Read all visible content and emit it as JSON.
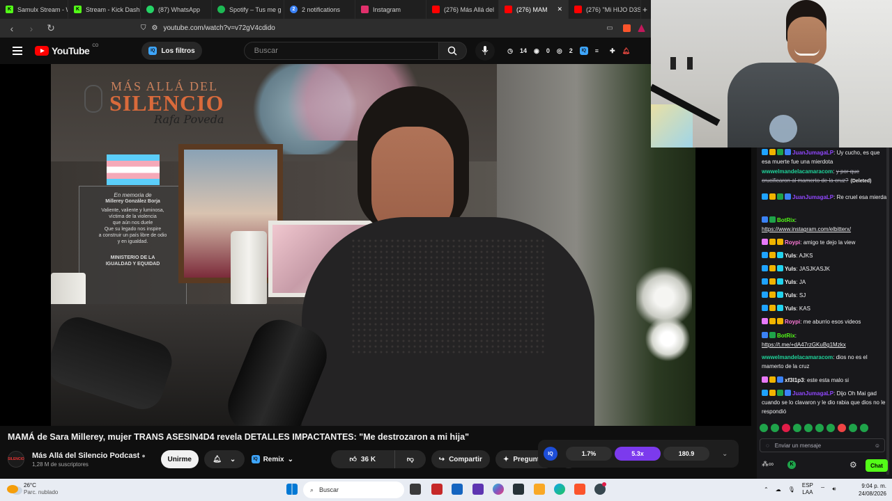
{
  "browser": {
    "tabs": [
      {
        "label": "Samulx Stream - W",
        "icon": "kick",
        "color": "#53fc18"
      },
      {
        "label": "Stream - Kick Dashb",
        "icon": "kick",
        "color": "#53fc18"
      },
      {
        "label": "(87) WhatsApp",
        "icon": "whatsapp",
        "color": "#25d366"
      },
      {
        "label": "Spotify – Tus me g",
        "icon": "spotify",
        "color": "#1db954"
      },
      {
        "label": "2 notifications",
        "icon": "notifications",
        "color": "#3b82f6"
      },
      {
        "label": "Instagram",
        "icon": "instagram",
        "color": "#e1306c"
      },
      {
        "label": "(276) Más Allá del",
        "icon": "youtube",
        "color": "#ff0000"
      },
      {
        "label": "(276) MAM",
        "icon": "youtube",
        "color": "#ff0000"
      },
      {
        "label": "(276) \"Mi HIJO D3S",
        "icon": "youtube",
        "color": "#ff0000"
      }
    ],
    "new_tab": "+",
    "url": "youtube.com/watch?v=v72gV4cdido"
  },
  "youtube": {
    "logo_text": "YouTube",
    "logo_cc": "CO",
    "filters_label": "Los filtros",
    "search_placeholder": "Buscar",
    "header_stats": {
      "timer": "14",
      "views": "0",
      "watch": "2"
    },
    "video_overlay": {
      "brand_line1": "MÁS ALLÁ DEL",
      "brand_line2": "SILENCIO",
      "brand_signature": "Rafa Poveda",
      "plaque_title": "En memoria de",
      "plaque_name": "Millerey González Borja",
      "plaque_lines": [
        "Valiente, valiente y luminosa,",
        "víctima de la violencia",
        "que aún nos duele",
        "Que su legado nos inspire",
        "a construir un país libre de odio",
        "y en igualdad."
      ],
      "plaque_footer1": "MINISTERIO DE LA",
      "plaque_footer2": "IGUALDAD Y EQUIDAD"
    },
    "video_title": "MAMÁ de Sara Millerey, mujer TRANS ASESIN4D4 revela DETALLES IMPACTANTES: \"Me destrozaron a mi hija\"",
    "channel": {
      "name": "Más Allá del Silencio Podcast",
      "subscribers": "1,28 M de suscriptores",
      "avatar_text": "SILENCIO"
    },
    "buttons": {
      "join": "Unirme",
      "remix": "Remix",
      "likes": "36 K",
      "share": "Compartir",
      "ask": "Preguntar"
    },
    "iq_panel": {
      "badge": "IQ",
      "values": [
        "1.7%",
        "5.3x",
        "180.9"
      ]
    }
  },
  "chat": {
    "messages": [
      {
        "user": "JuanJumagaLP",
        "color": "#9147ff",
        "text": "Uy cucho, es que esa muerte fue una mierdota",
        "badges": [
          "#1fa3ff",
          "#f0b400",
          "#1fa34a",
          "#3b82f6"
        ]
      },
      {
        "user": "wwwelmandelacamaracom",
        "color": "#1fd39a",
        "text": "y por que crucificaron al mamerto de la cruz?",
        "deleted": "(Deleted)",
        "badges": []
      },
      {
        "user": "JuanJumagaLP",
        "color": "#9147ff",
        "text": "Re cruel esa mierda",
        "badges": [
          "#1fa3ff",
          "#f0b400",
          "#1fa34a",
          "#3b82f6"
        ]
      },
      {
        "user": "BotRix",
        "color": "#53fc18",
        "text": "https://www.instagram.com/elbitterx/",
        "badges": [
          "#3b82f6",
          "#1fa34a"
        ],
        "link": true
      },
      {
        "user": "Roypi",
        "color": "#ff7ad9",
        "text": "amigo te dejo la view",
        "badges": [
          "#e879f9",
          "#f0b400",
          "#f0b400"
        ]
      },
      {
        "user": "Yuls",
        "color": "#f1f1f1",
        "text": "AJKS",
        "badges": [
          "#1fa3ff",
          "#f0b400",
          "#22d3ee"
        ]
      },
      {
        "user": "Yuls",
        "color": "#f1f1f1",
        "text": "JASJKASJK",
        "badges": [
          "#1fa3ff",
          "#f0b400",
          "#22d3ee"
        ]
      },
      {
        "user": "Yuls",
        "color": "#f1f1f1",
        "text": "JA",
        "badges": [
          "#1fa3ff",
          "#f0b400",
          "#22d3ee"
        ]
      },
      {
        "user": "Yuls",
        "color": "#f1f1f1",
        "text": "SJ",
        "badges": [
          "#1fa3ff",
          "#f0b400",
          "#22d3ee"
        ]
      },
      {
        "user": "Yuls",
        "color": "#f1f1f1",
        "text": "KAS",
        "badges": [
          "#1fa3ff",
          "#f0b400",
          "#22d3ee"
        ]
      },
      {
        "user": "Roypi",
        "color": "#ff7ad9",
        "text": "me aburrio esos videos",
        "badges": [
          "#e879f9",
          "#f0b400",
          "#f0b400"
        ]
      },
      {
        "user": "BotRix",
        "color": "#53fc18",
        "text": "https://t.me/+dA47rzGKuBg1Mzkx",
        "badges": [
          "#3b82f6",
          "#1fa34a"
        ],
        "link": true
      },
      {
        "user": "wwwelmandelacamaracom",
        "color": "#1fd39a",
        "text": "dios no es el mamerto de la cruz",
        "badges": []
      },
      {
        "user": "xf3l1p3",
        "color": "#f1f1f1",
        "text": "este esta malo si",
        "badges": [
          "#e879f9",
          "#f0b400",
          "#3b82f6"
        ]
      },
      {
        "user": "JuanJumagaLP",
        "color": "#9147ff",
        "text": "Dijo Oh Mai gad cuando se lo clavaron y le dio rabia que dios no le respondió",
        "badges": [
          "#1fa3ff",
          "#f0b400",
          "#1fa34a",
          "#3b82f6"
        ]
      }
    ],
    "input_placeholder": "Enviar un mensaje",
    "send_label": "Chat"
  },
  "taskbar": {
    "temperature": "26°C",
    "weather_desc": "Parc. nublado",
    "search_label": "Buscar",
    "lang_line1": "ESP",
    "lang_line2": "LAA",
    "time": "9:04 p. m.",
    "date": "24/08/2026"
  }
}
